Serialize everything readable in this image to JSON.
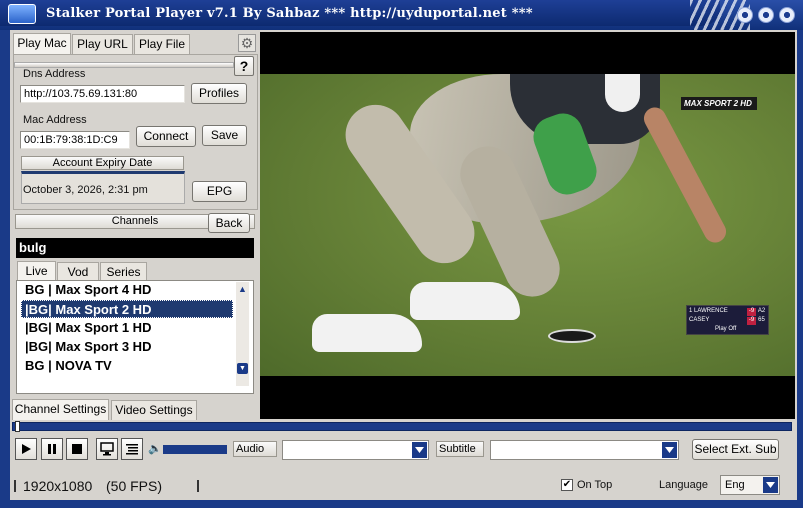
{
  "window": {
    "title": "Stalker Portal Player v7.1 By Sahbaz   *** http://uyduportal.net ***"
  },
  "play_tabs": [
    "Play Mac",
    "Play URL",
    "Play File"
  ],
  "help_label": "?",
  "dns": {
    "label": "Dns Address",
    "value": "http://103.75.69.131:80",
    "profiles_label": "Profiles"
  },
  "mac": {
    "label": "Mac Address",
    "value": "00:1B:79:38:1D:C9",
    "connect_label": "Connect",
    "save_label": "Save"
  },
  "expiry": {
    "label": "Account Expiry Date",
    "value": "October 3, 2026, 2:31 pm",
    "epg_label": "EPG"
  },
  "channels": {
    "header": "Channels",
    "back_label": "Back",
    "search_value": "bulg",
    "type_tabs": [
      "Live",
      "Vod",
      "Series"
    ],
    "items": [
      "BG | Max Sport 4 HD",
      "|BG| Max Sport 2 HD",
      "|BG| Max Sport 1 HD",
      "|BG| Max Sport 3 HD",
      "BG | NOVA TV"
    ],
    "selected_index": 1
  },
  "settings_tabs": [
    "Channel Settings",
    "Video Settings"
  ],
  "overlay": {
    "logo_text": "MAX SPORT 2 HD",
    "score": {
      "rows": [
        {
          "name": "1  LAWRENCE",
          "a": "-9",
          "b": "A2"
        },
        {
          "name": "CASEY",
          "a": "-9",
          "b": "65"
        }
      ],
      "footer": "Play Off"
    }
  },
  "controls": {
    "audio_label": "Audio",
    "subtitle_label": "Subtitle",
    "select_sub_label": "Select Ext. Sub",
    "volume_level": 1.0
  },
  "status": {
    "resolution": "1920x1080",
    "fps": "(50 FPS)",
    "ontop_label": "On Top",
    "ontop_checked": true,
    "language_label": "Language",
    "language_value": "Eng"
  },
  "colors": {
    "frame": "#1a3a88",
    "accent": "#1f3a70"
  }
}
